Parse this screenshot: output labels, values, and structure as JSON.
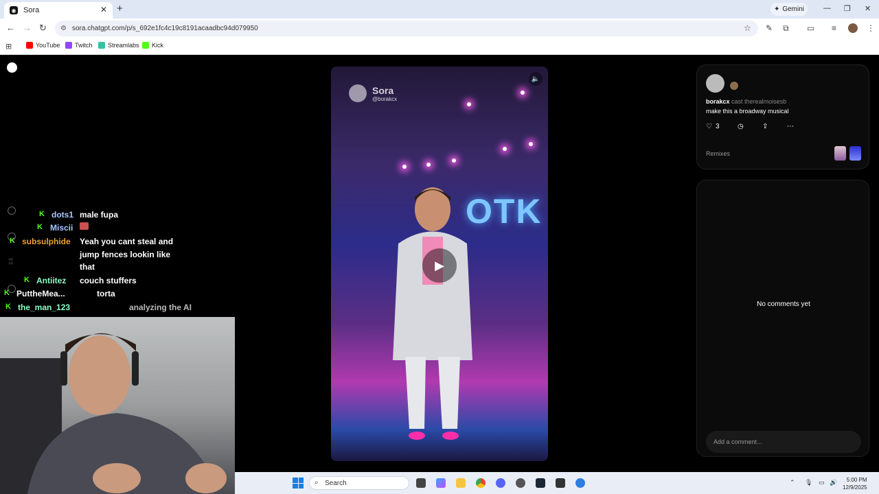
{
  "browser": {
    "tab_title": "Sora",
    "new_tab": "+",
    "gemini_label": "Gemini",
    "url": "sora.chatgpt.com/p/s_692e1fc4c19c8191acaadbc94d079950",
    "bookmarks": [
      "YouTube",
      "Twitch",
      "Streamlabs",
      "Kick"
    ]
  },
  "chat": [
    {
      "user": "dots1",
      "message": "male fupa",
      "color": "#a8c8ff"
    },
    {
      "user": "Miscii",
      "message": "",
      "color": "#a8c8ff"
    },
    {
      "user": "subsulphide",
      "message": "Yeah you cant steal and",
      "color": "#f0a030"
    },
    {
      "user": "",
      "message": "jump fences lookin like",
      "color": "#fff"
    },
    {
      "user": "",
      "message": "that",
      "color": "#fff"
    },
    {
      "user": "Antiitez",
      "message": "couch stuffers",
      "color": "#8affc8"
    },
    {
      "user": "PuttheMea...",
      "message": "torta",
      "color": "#fff"
    },
    {
      "user": "the_man_123",
      "message": "analyzing the AI",
      "color": "#8affc8"
    }
  ],
  "video": {
    "brand": "Sora",
    "handle": "@borakcx",
    "stage_sign": "OTK"
  },
  "post": {
    "author": "borakcx",
    "cast_text": "cast therealmoisesb",
    "prompt": "make this a broadway musical",
    "likes": "3",
    "remixes_label": "Remixes"
  },
  "comments": {
    "empty_text": "No comments yet",
    "placeholder": "Add a comment..."
  },
  "taskbar": {
    "search_label": "Search",
    "time": "5:00 PM",
    "date": "12/9/2025"
  },
  "colors": {
    "kick_green": "#53fc18",
    "accent": "#1a7fe0"
  }
}
